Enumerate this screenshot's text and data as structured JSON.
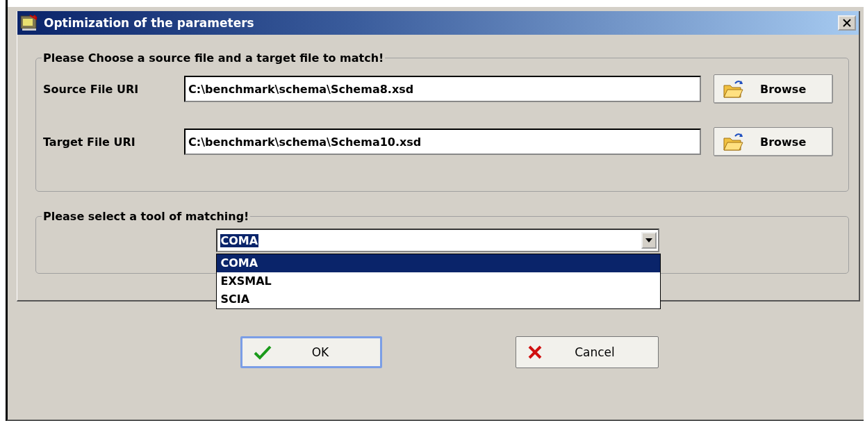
{
  "window": {
    "title": "Optimization of the parameters"
  },
  "file_group": {
    "legend": "Please Choose a source file and a target file to match!",
    "rows": [
      {
        "label": "Source File URI",
        "value": "C:\\benchmark\\schema\\Schema8.xsd",
        "button": "Browse"
      },
      {
        "label": "Target File URI",
        "value": "C:\\benchmark\\schema\\Schema10.xsd",
        "button": "Browse"
      }
    ]
  },
  "tool_group": {
    "legend": "Please select a tool of matching!",
    "combo": {
      "value": "COMA",
      "expanded": true,
      "options": [
        {
          "label": "COMA",
          "selected": true
        },
        {
          "label": "EXSMAL",
          "selected": false
        },
        {
          "label": "SCIA",
          "selected": false
        }
      ]
    }
  },
  "buttons": [
    {
      "kind": "ok",
      "label": "OK",
      "focused": true
    },
    {
      "kind": "cancel",
      "label": "Cancel",
      "focused": false
    }
  ]
}
